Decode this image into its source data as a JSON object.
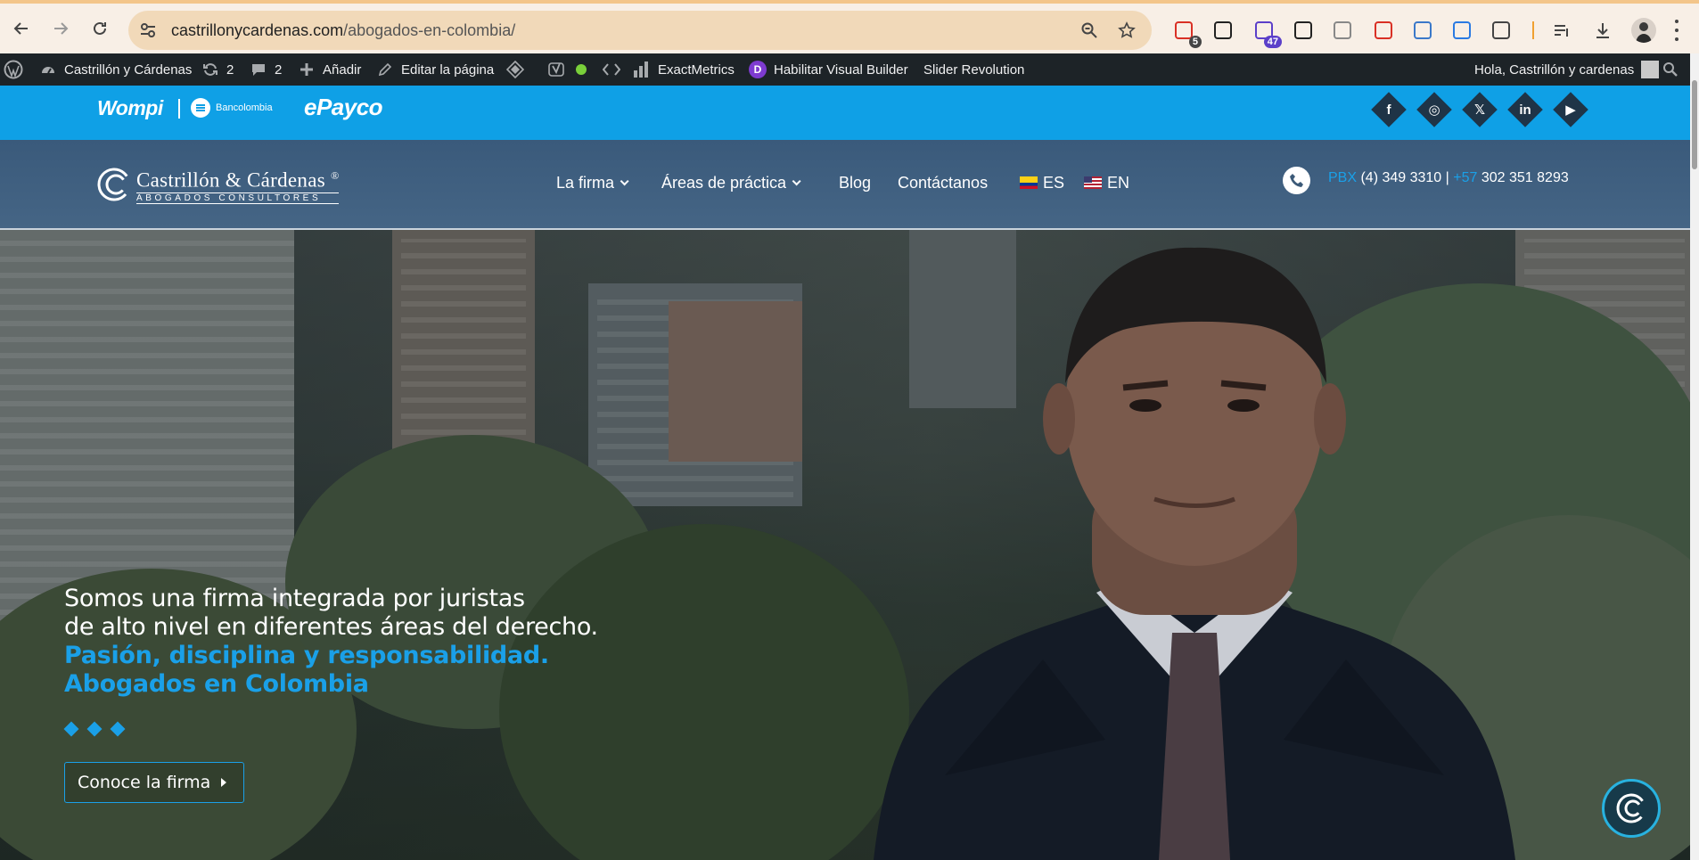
{
  "browser": {
    "url_host": "castrillonycardenas.com",
    "url_path": "/abogados-en-colombia/",
    "extensions": [
      {
        "name": "ext-calendar-icon",
        "badge": "5",
        "color": "#d93025"
      },
      {
        "name": "eyedropper-icon",
        "badge": "",
        "color": "#222"
      },
      {
        "name": "ext-purple-icon",
        "badge": "47",
        "color": "#5b3fc9"
      },
      {
        "name": "pip-icon",
        "badge": "",
        "color": "#222"
      },
      {
        "name": "camera-icon",
        "badge": "",
        "color": "#888"
      },
      {
        "name": "ext-red-icon",
        "badge": "",
        "color": "#d93025"
      },
      {
        "name": "wordpress-icon",
        "badge": "",
        "color": "#3a78c9"
      },
      {
        "name": "ext-blue-check-icon",
        "badge": "",
        "color": "#2a7ae2"
      },
      {
        "name": "puzzle-icon",
        "badge": "",
        "color": "#444"
      }
    ]
  },
  "adminbar": {
    "site_name": "Castrillón y Cárdenas",
    "updates_count": "2",
    "comments_count": "2",
    "add_label": "Añadir",
    "edit_label": "Editar la página",
    "exactmetrics_label": "ExactMetrics",
    "visual_builder_label": "Habilitar Visual Builder",
    "slider_label": "Slider Revolution",
    "greeting": "Hola, Castrillón y cardenas"
  },
  "topbar": {
    "wompi": "Wompi",
    "bancolombia": "Bancolombia",
    "epayco": "ePayco",
    "social": [
      {
        "name": "facebook-icon",
        "glyph": "f"
      },
      {
        "name": "instagram-icon",
        "glyph": "◎"
      },
      {
        "name": "x-icon",
        "glyph": "𝕏"
      },
      {
        "name": "linkedin-icon",
        "glyph": "in"
      },
      {
        "name": "youtube-icon",
        "glyph": "▶"
      }
    ]
  },
  "header": {
    "brand_name": "Castrillón & Cárdenas",
    "brand_reg": "®",
    "brand_sub": "ABOGADOS CONSULTORES",
    "menu": {
      "firma": "La firma",
      "areas": "Áreas de práctica",
      "blog": "Blog",
      "contact": "Contáctanos",
      "es": "ES",
      "en": "EN"
    },
    "pbx_label": "PBX",
    "pbx_number": "(4) 349 3310",
    "sep": "|",
    "cc_label": "+57",
    "mobile_number": "302 351 8293"
  },
  "hero": {
    "line1": "Somos una firma integrada por juristas",
    "line2": "de alto nivel en diferentes áreas del derecho.",
    "line3": "Pasión, disciplina y responsabilidad.",
    "line4": "Abogados en Colombia",
    "cta": "Conoce la firma"
  },
  "colors": {
    "accent": "#1aa0e8",
    "topbar": "#0fa0e6",
    "header": "#3c5a78",
    "adminbar": "#1d2327"
  }
}
